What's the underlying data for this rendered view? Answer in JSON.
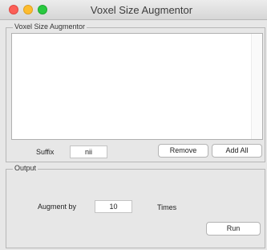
{
  "window": {
    "title": "Voxel Size Augmentor"
  },
  "augmentor_panel": {
    "title": "Voxel Size Augmentor",
    "suffix_label": "Suffix",
    "suffix_value": "nii",
    "remove_label": "Remove",
    "add_all_label": "Add All"
  },
  "output_panel": {
    "title": "Output",
    "augment_label": "Augment by",
    "augment_value": "10",
    "times_label": "Times",
    "run_label": "Run"
  }
}
